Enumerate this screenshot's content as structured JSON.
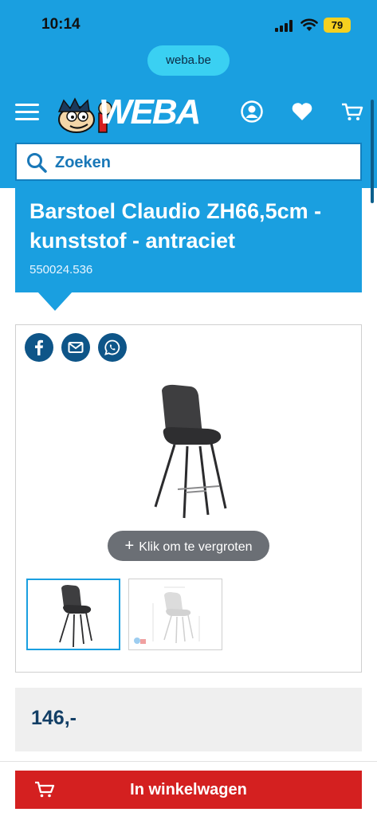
{
  "status_bar": {
    "time": "10:14",
    "battery": "79"
  },
  "browser": {
    "url": "weba.be"
  },
  "header": {
    "logo_text": "WEBA",
    "icons": [
      "menu-icon",
      "account-icon",
      "heart-icon",
      "cart-icon"
    ]
  },
  "search": {
    "placeholder": "Zoeken"
  },
  "product": {
    "title": "Barstoel Claudio ZH66,5cm - kunststof - antraciet",
    "sku": "550024.536",
    "price": "146,-"
  },
  "gallery": {
    "share_icons": [
      "facebook-icon",
      "mail-icon",
      "whatsapp-icon"
    ],
    "zoom_label": "Klik om te vergroten",
    "thumbnails": 2
  },
  "cart_button": {
    "label": "In winkelwagen"
  },
  "colors": {
    "brand_blue": "#1a9fe0",
    "dark_blue": "#0e5588",
    "cart_red": "#d42020"
  }
}
